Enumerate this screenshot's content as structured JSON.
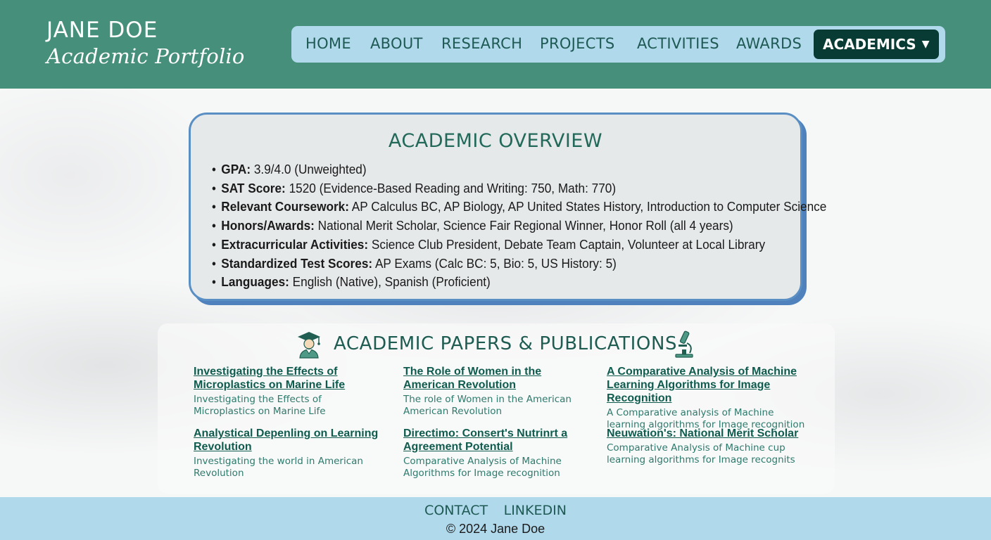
{
  "brand": {
    "name": "JANE DOE",
    "subtitle": "Academic Portfolio"
  },
  "nav": {
    "items": [
      "HOME",
      "ABOUT",
      "RESEARCH",
      "PROJECTS",
      "ACTIVITIES",
      "AWARDS"
    ],
    "active": "ACADEMICS",
    "active_icon": "caret-down-icon"
  },
  "overview": {
    "title": "ACADEMIC OVERVIEW",
    "items": [
      {
        "label": "GPA:",
        "value": " 3.9/4.0 (Unweighted)"
      },
      {
        "label": "SAT Score:",
        "value": " 1520 (Evidence-Based Reading and Writing: 750, Math: 770)"
      },
      {
        "label": "Relevant Coursework:",
        "value": " AP Calculus BC, AP Biology, AP United States History, Introduction to Computer Science"
      },
      {
        "label": "Honors/Awards:",
        "value": " National Merit Scholar, Science Fair Regional Winner, Honor Roll (all 4 years)"
      },
      {
        "label": "Extracurricular Activities:",
        "value": " Science Club President, Debate Team Captain, Volunteer at Local Library"
      },
      {
        "label": "Standardized Test Scores:",
        "value": " AP Exams (Calc BC: 5, Bio: 5, US History: 5)"
      },
      {
        "label": "Languages:",
        "value": " English (Native), Spanish (Proficient)"
      }
    ]
  },
  "papers": {
    "title": "ACADEMIC PAPERS & PUBLICATIONS",
    "left_icon": "graduate-icon",
    "right_icon": "microscope-icon",
    "items": [
      {
        "title": "Investigating the Effects of Microplastics on Marine Life",
        "desc": "Investigating the Effects of Microplastics on Marine Life"
      },
      {
        "title": "The Role of Women in the American Revolution",
        "desc": "The role of Women in the American American Revolution"
      },
      {
        "title": "A Comparative Analysis of Machine Learning Algorithms for Image Recognition",
        "desc": "A Comparative analysis of Machine learning algorithms for Image recognition"
      },
      {
        "title": "Analystical Depenling on Learning Revolution",
        "desc": "Investigating the world in American Revolution"
      },
      {
        "title": "Directimo: Consert's Nutrinrt a Agreement Potential",
        "desc": "Comparative Analysis of Machine Algorithms for Image recognition"
      },
      {
        "title": "Neuwation's: National Merit Scholar",
        "desc": "Comparative Analysis of Machine cup learning algorithms for Image recognits"
      }
    ]
  },
  "footer": {
    "links": [
      "CONTACT",
      "LINKEDIN"
    ],
    "copyright": "© 2024 Jane Doe"
  },
  "colors": {
    "header": "#468f7a",
    "nav_bg": "#b0d9ec",
    "nav_active": "#073b33",
    "accent": "#22695a",
    "overview_border": "#5a8fc4"
  }
}
